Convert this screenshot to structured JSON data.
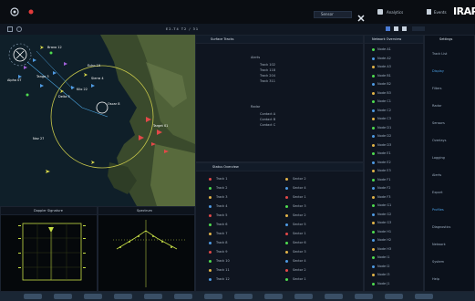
{
  "topbar": {
    "left_icons": [
      "target-icon",
      "record-icon"
    ],
    "items": [
      {
        "label": "Sensor",
        "icon": "gear-icon"
      },
      {
        "label": "Analytics",
        "icon": "chart-icon"
      },
      {
        "label": "Events",
        "icon": "bell-icon"
      }
    ],
    "brand": "IRAPID"
  },
  "map": {
    "toolbar_title": "E2-T4 T2 / 31",
    "labels": [
      {
        "text": "Bravo 12"
      },
      {
        "text": "Alpha 07"
      },
      {
        "text": "Tango 3"
      },
      {
        "text": "Kilo 22"
      },
      {
        "text": "Delta 5"
      },
      {
        "text": "Echo 19"
      },
      {
        "text": "Sierra 4"
      },
      {
        "text": "Oscar 8"
      },
      {
        "text": "Target 01"
      },
      {
        "text": "Nav 27"
      }
    ]
  },
  "mid_panel": {
    "title": "Surface Tracks",
    "sections": [
      {
        "label": "Alerts",
        "items": [
          "Track 102",
          "Track 118",
          "Track 204",
          "Track 311"
        ]
      },
      {
        "label": "Radar",
        "items": [
          "Contact A",
          "Contact B",
          "Contact C"
        ]
      }
    ],
    "list": [
      {
        "a": "Track 1",
        "b": "Sector 2"
      },
      {
        "a": "Track 2",
        "b": "Sector 4"
      },
      {
        "a": "Track 3",
        "b": "Sector 1"
      },
      {
        "a": "Track 4",
        "b": "Sector 3"
      },
      {
        "a": "Track 5",
        "b": "Sector 2"
      },
      {
        "a": "Track 6",
        "b": "Sector 5"
      },
      {
        "a": "Track 7",
        "b": "Sector 1"
      },
      {
        "a": "Track 8",
        "b": "Sector 6"
      },
      {
        "a": "Track 9",
        "b": "Sector 3"
      },
      {
        "a": "Track 10",
        "b": "Sector 4"
      },
      {
        "a": "Track 11",
        "b": "Sector 2"
      },
      {
        "a": "Track 12",
        "b": "Sector 1"
      }
    ],
    "second_title": "Status Overview"
  },
  "right_panel": {
    "title": "Network Overview",
    "list": [
      "Node A1",
      "Node A2",
      "Node A3",
      "Node B1",
      "Node B2",
      "Node B3",
      "Node C1",
      "Node C2",
      "Node C3",
      "Node D1",
      "Node D2",
      "Node D3",
      "Node E1",
      "Node E2",
      "Node E3",
      "Node F1",
      "Node F2",
      "Node F3",
      "Node G1",
      "Node G2",
      "Node G3",
      "Node H1",
      "Node H2",
      "Node H3",
      "Node I1",
      "Node I2",
      "Node I3",
      "Node J1"
    ]
  },
  "sidebar": {
    "title": "Settings",
    "items": [
      "Track List",
      "Display",
      "Filters",
      "Radar",
      "Sensors",
      "Overlays",
      "Logging",
      "Alerts",
      "Export",
      "Profiles",
      "Diagnostics",
      "Network",
      "System",
      "Help"
    ]
  },
  "bottom_panel": {
    "left_title": "Doppler Signature",
    "right_title": "Spectrum"
  },
  "taskbar": {
    "items": [
      "app1",
      "app2",
      "app3",
      "app4",
      "app5",
      "app6",
      "app7",
      "app8",
      "app9",
      "app10",
      "app11",
      "app12",
      "app13",
      "app14"
    ]
  }
}
